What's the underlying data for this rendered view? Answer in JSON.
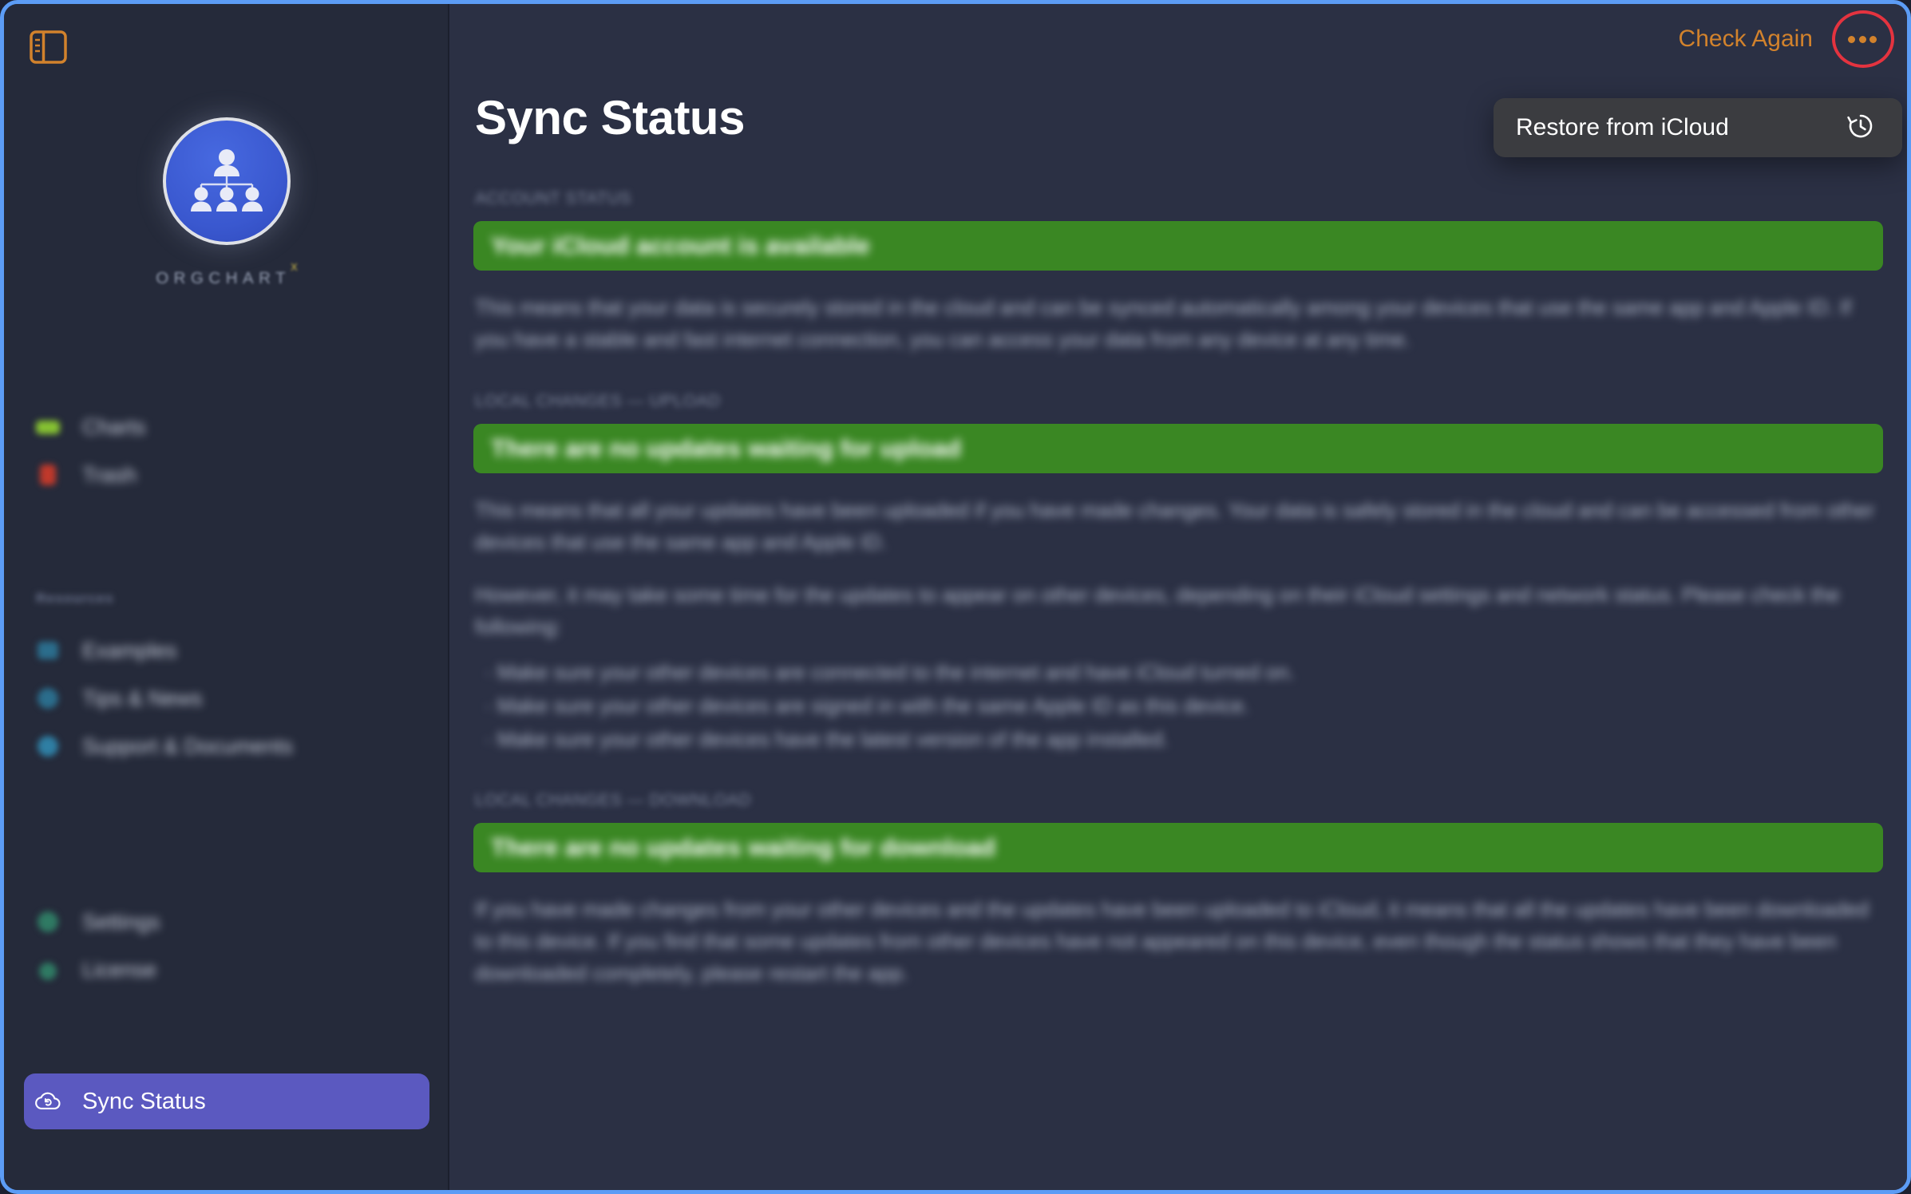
{
  "window": {
    "accent_border": "#5c9cf5"
  },
  "sidebar": {
    "toggle_icon": "sidebar-toggle-icon",
    "brand": {
      "name": "ORGCHART",
      "superscript": "X",
      "icon": "org-chart-avatar-icon"
    },
    "primary_items": [
      {
        "label": "Charts",
        "icon": "charts-icon",
        "color": "#86c232"
      },
      {
        "label": "Trash",
        "icon": "trash-icon",
        "color": "#c0392b"
      }
    ],
    "section_header": "Resources",
    "resource_items": [
      {
        "label": "Examples",
        "icon": "examples-icon",
        "color": "#2b6d8c"
      },
      {
        "label": "Tips & News",
        "icon": "tips-news-icon",
        "color": "#2b6d8c"
      },
      {
        "label": "Support & Documents",
        "icon": "support-documents-icon",
        "color": "#2b6d8c"
      }
    ],
    "footer_items": [
      {
        "label": "Settings",
        "icon": "settings-gear-icon",
        "color": "#2f7a63"
      },
      {
        "label": "License",
        "icon": "license-key-icon",
        "color": "#2f7a63"
      }
    ],
    "active_item": {
      "label": "Sync Status",
      "icon": "cloud-sync-icon",
      "highlight": "#5b59c0"
    }
  },
  "topbar": {
    "check_again_label": "Check Again",
    "check_again_color": "#d2822c",
    "more_icon": "ellipsis-icon",
    "highlight_ring_color": "#e4333f"
  },
  "menu": {
    "items": [
      {
        "label": "Restore from iCloud",
        "icon": "clock-restore-icon"
      }
    ]
  },
  "main": {
    "title": "Sync Status",
    "sections": [
      {
        "kicker": "ACCOUNT STATUS",
        "banner": "Your iCloud account is available",
        "banner_color": "#3a8723",
        "paragraphs": [
          "This means that your data is securely stored in the cloud and can be synced automatically among your devices that use the same app and Apple ID. If you have a stable and fast internet connection, you can access your data from any device at any time."
        ],
        "bullets": []
      },
      {
        "kicker": "LOCAL CHANGES — UPLOAD",
        "banner": "There are no updates waiting for upload",
        "banner_color": "#3a8723",
        "paragraphs": [
          "This means that all your updates have been uploaded if you have made changes. Your data is safely stored in the cloud and can be accessed from other devices that use the same app and Apple ID.",
          "However, it may take some time for the updates to appear on other devices, depending on their iCloud settings and network status. Please check the following:"
        ],
        "bullets": [
          "Make sure your other devices are connected to the internet and have iCloud turned on.",
          "Make sure your other devices are signed in with the same Apple ID as this device.",
          "Make sure your other devices have the latest version of the app installed."
        ]
      },
      {
        "kicker": "LOCAL CHANGES — DOWNLOAD",
        "banner": "There are no updates waiting for download",
        "banner_color": "#3a8723",
        "paragraphs": [
          "If you have made changes from your other devices and the updates have been uploaded to iCloud, it means that all the updates have been downloaded to this device. If you find that some updates from other devices have not appeared on this device, even though the status shows that they have been downloaded completely, please restart the app."
        ],
        "bullets": []
      }
    ]
  }
}
